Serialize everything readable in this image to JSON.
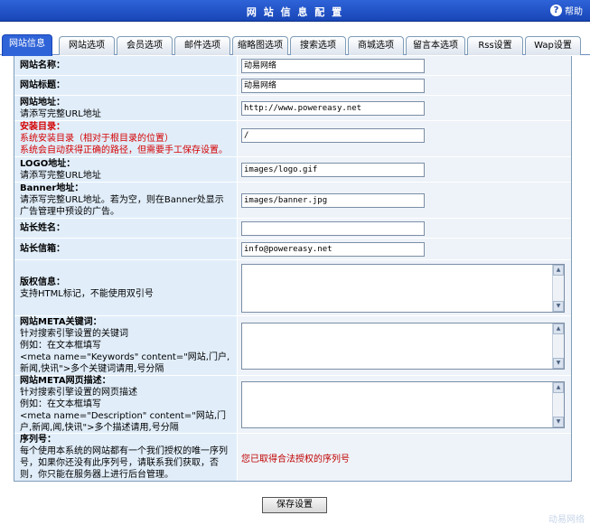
{
  "header": {
    "title": "网 站 信 息 配 置",
    "help_label": "帮助"
  },
  "tabs": [
    {
      "label": "网站信息",
      "active": true
    },
    {
      "label": "网站选项"
    },
    {
      "label": "会员选项"
    },
    {
      "label": "邮件选项"
    },
    {
      "label": "缩略图选项"
    },
    {
      "label": "搜索选项"
    },
    {
      "label": "商城选项"
    },
    {
      "label": "留言本选项"
    },
    {
      "label": "Rss设置"
    },
    {
      "label": "Wap设置"
    }
  ],
  "fields": {
    "site_name": {
      "label": "网站名称：",
      "value": "动易网络"
    },
    "site_title": {
      "label": "网站标题：",
      "value": "动易网络"
    },
    "site_url": {
      "label": "网站地址：",
      "hint": "请添写完整URL地址",
      "value": "http://www.powereasy.net"
    },
    "install_dir": {
      "label": "安装目录：",
      "hint1": "系统安装目录（相对于根目录的位置）",
      "hint2": "系统会自动获得正确的路径，但需要手工保存设置。",
      "value": "/"
    },
    "logo": {
      "label": "LOGO地址：",
      "hint": "请添写完整URL地址",
      "value": "images/logo.gif"
    },
    "banner": {
      "label": "Banner地址：",
      "hint": "请添写完整URL地址。若为空，则在Banner处显示广告管理中预设的广告。",
      "value": "images/banner.jpg"
    },
    "webmaster_name": {
      "label": "站长姓名：",
      "value": ""
    },
    "webmaster_email": {
      "label": "站长信箱：",
      "value": "info@powereasy.net"
    },
    "copyright": {
      "label": "版权信息：",
      "hint": "支持HTML标记，不能使用双引号",
      "value": ""
    },
    "meta_keywords": {
      "label": "网站META关键词：",
      "hint1": "针对搜索引擎设置的关键词",
      "hint2": "例如：在文本框填写",
      "hint3": "<meta name=\"Keywords\" content=\"网站,门户,新闻,快讯\">多个关键词请用,号分隔",
      "value": ""
    },
    "meta_description": {
      "label": "网站META网页描述：",
      "hint1": "针对搜索引擎设置的网页描述",
      "hint2": "例如：在文本框填写",
      "hint3": "<meta name=\"Description\" content=\"网站,门户,新闻,闻,快讯\">多个描述请用,号分隔",
      "value": ""
    },
    "serial": {
      "label": "序列号：",
      "hint": "每个使用本系统的网站都有一个我们授权的唯一序列号，如果你还没有此序列号，请联系我们获取，否则，你只能在服务器上进行后台管理。",
      "status": "您已取得合法授权的序列号"
    }
  },
  "save_button": "保存设置",
  "footer": "动易网络"
}
